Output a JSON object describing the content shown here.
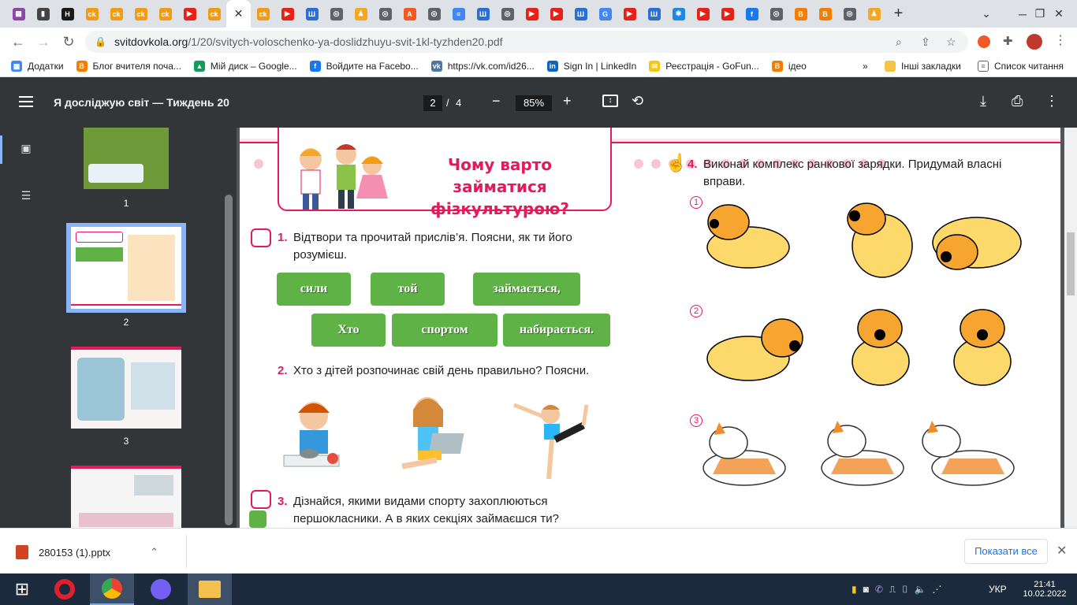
{
  "tabs": [
    {
      "icon": "grid-icon",
      "color": "#8e44ad",
      "glyph": "▦"
    },
    {
      "icon": "book-icon",
      "color": "#444",
      "glyph": "▮"
    },
    {
      "icon": "h-icon",
      "color": "#1a1a1a",
      "glyph": "H"
    },
    {
      "icon": "cq-icon",
      "color": "#f39c12",
      "glyph": "ck"
    },
    {
      "icon": "cq-icon",
      "color": "#f39c12",
      "glyph": "ck"
    },
    {
      "icon": "cq-icon",
      "color": "#f39c12",
      "glyph": "ck"
    },
    {
      "icon": "cq-icon",
      "color": "#f39c12",
      "glyph": "ck"
    },
    {
      "icon": "youtube-icon",
      "color": "#e62117",
      "glyph": "▶"
    },
    {
      "icon": "cq-icon",
      "color": "#f39c12",
      "glyph": "ck"
    },
    {
      "icon": "close-icon",
      "color": "#ffffff",
      "glyph": "✕",
      "active": true
    },
    {
      "icon": "cq-icon",
      "color": "#f39c12",
      "glyph": "ck"
    },
    {
      "icon": "youtube-icon",
      "color": "#e62117",
      "glyph": "▶"
    },
    {
      "icon": "trident-icon",
      "color": "#2a6fd6",
      "glyph": "Ш"
    },
    {
      "icon": "chrome-icon",
      "color": "#5f6368",
      "glyph": "◎"
    },
    {
      "icon": "bell-icon",
      "color": "#f5a623",
      "glyph": "♟"
    },
    {
      "icon": "chrome-icon",
      "color": "#5f6368",
      "glyph": "◎"
    },
    {
      "icon": "a-icon",
      "color": "#f15a24",
      "glyph": "A"
    },
    {
      "icon": "chrome-icon",
      "color": "#5f6368",
      "glyph": "◎"
    },
    {
      "icon": "docs-icon",
      "color": "#4285f4",
      "glyph": "≡"
    },
    {
      "icon": "trident-icon",
      "color": "#2a6fd6",
      "glyph": "Ш"
    },
    {
      "icon": "chrome-icon",
      "color": "#5f6368",
      "glyph": "◎"
    },
    {
      "icon": "youtube-icon",
      "color": "#e62117",
      "glyph": "▶"
    },
    {
      "icon": "youtube-icon",
      "color": "#e62117",
      "glyph": "▶"
    },
    {
      "icon": "trident-icon",
      "color": "#2a6fd6",
      "glyph": "Ш"
    },
    {
      "icon": "google-icon",
      "color": "#4285f4",
      "glyph": "G"
    },
    {
      "icon": "youtube-icon",
      "color": "#e62117",
      "glyph": "▶"
    },
    {
      "icon": "trident-icon",
      "color": "#2a6fd6",
      "glyph": "Ш"
    },
    {
      "icon": "star-icon",
      "color": "#1e88e5",
      "glyph": "✱"
    },
    {
      "icon": "youtube-icon",
      "color": "#e62117",
      "glyph": "▶"
    },
    {
      "icon": "youtube-icon",
      "color": "#e62117",
      "glyph": "▶"
    },
    {
      "icon": "facebook-icon",
      "color": "#1877f2",
      "glyph": "f"
    },
    {
      "icon": "chrome-icon",
      "color": "#5f6368",
      "glyph": "◎"
    },
    {
      "icon": "blogger-icon",
      "color": "#f57d00",
      "glyph": "B"
    },
    {
      "icon": "blogger-icon",
      "color": "#f57d00",
      "glyph": "B"
    },
    {
      "icon": "chrome-icon",
      "color": "#5f6368",
      "glyph": "◎"
    },
    {
      "icon": "bell-icon",
      "color": "#f5a623",
      "glyph": "♟"
    }
  ],
  "new_tab_glyph": "+",
  "url": {
    "domain": "svitdovkola.org",
    "path": "/1/20/svitych-voloschenko-ya-doslidzhuyu-svit-1kl-tyzhden20.pdf"
  },
  "bookmarks": [
    {
      "label": "Додатки",
      "color": "#4285f4",
      "glyph": "▦"
    },
    {
      "label": "Блог вчителя поча...",
      "color": "#f57d00",
      "glyph": "B"
    },
    {
      "label": "Мій диск – Google...",
      "color": "#0f9d58",
      "glyph": "▲"
    },
    {
      "label": "Войдите на Facebo...",
      "color": "#1877f2",
      "glyph": "f"
    },
    {
      "label": "https://vk.com/id26...",
      "color": "#4a76a8",
      "glyph": "vk"
    },
    {
      "label": "Sign In | LinkedIn",
      "color": "#0a66c2",
      "glyph": "in"
    },
    {
      "label": "Реєстрація - GoFun...",
      "color": "#f5c518",
      "glyph": "✉"
    },
    {
      "label": "ідео",
      "color": "#f57d00",
      "glyph": "B"
    }
  ],
  "bookmarks_more": "»",
  "other_bookmarks": "Інші закладки",
  "reading_list": "Список читання",
  "pdf": {
    "title": "Я досліджую світ — Тиждень 20",
    "page": "2",
    "page_sep": "/",
    "page_total": "4",
    "zoom": "85%"
  },
  "thumbnails": [
    {
      "num": "1"
    },
    {
      "num": "2"
    },
    {
      "num": "3"
    }
  ],
  "content": {
    "banner_title": "Чому варто займатися фізкультурою?",
    "q1_num": "1.",
    "q1_text": "Відтвори та прочитай прислів’я. Поясни, як ти його розумієш.",
    "puzzle_words": [
      "сили",
      "той",
      "займається,",
      "Хто",
      "спортом",
      "набирається."
    ],
    "q2_num": "2.",
    "q2_text": "Хто з дітей розпочинає свій день правильно? Поясни.",
    "q3_num": "3.",
    "q3_text": "Дізнайся, якими видами спорту захоплюються першокласники. А в яких секціях займаєшся ти?",
    "q4_num": "4.",
    "q4_text": "Виконай комплекс ранкової зарядки. Придумай власні вправи.",
    "exercise_nums": [
      "1",
      "2",
      "3"
    ]
  },
  "download": {
    "filename": "280153 (1).pptx",
    "show_all": "Показати все"
  },
  "taskbar": {
    "lang": "УКР",
    "time": "21:41",
    "date": "10.02.2022"
  }
}
